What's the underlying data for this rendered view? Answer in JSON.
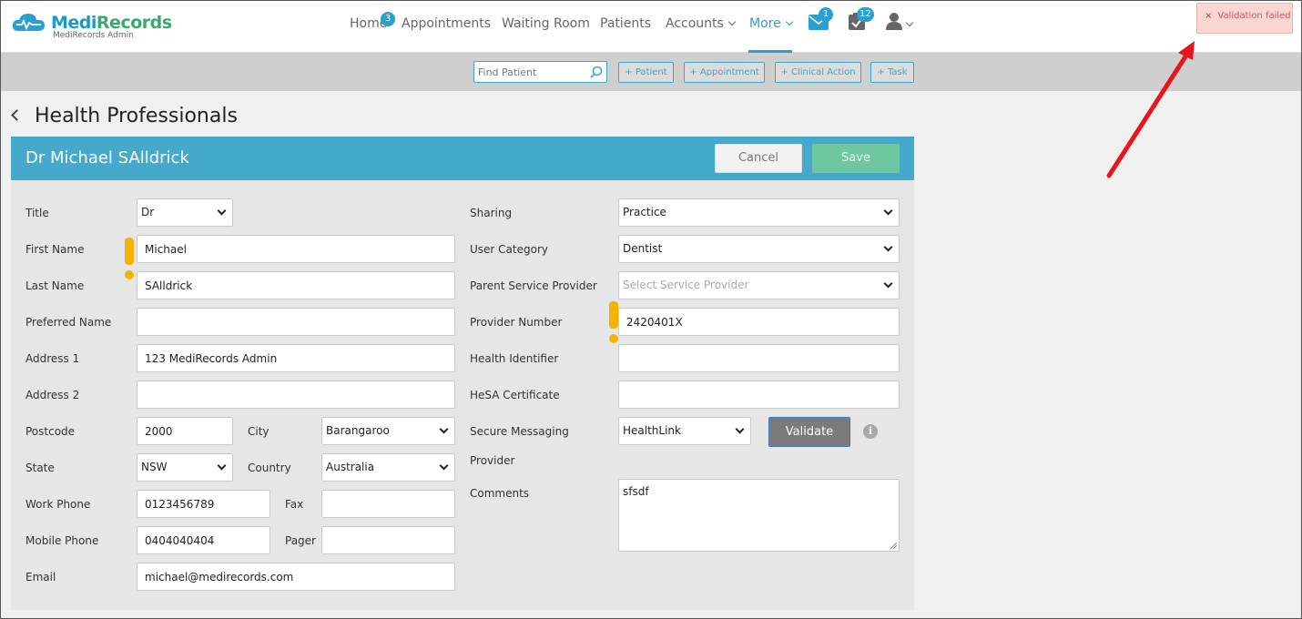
{
  "brand": {
    "name_a": "Medi",
    "name_b": "Records",
    "sub": "MediRecords Admin"
  },
  "nav": {
    "home": "Home",
    "home_badge": "3",
    "appointments": "Appointments",
    "waiting_room": "Waiting Room",
    "patients": "Patients",
    "accounts": "Accounts",
    "more": "More",
    "mail_badge": "1",
    "tasks_badge": "12"
  },
  "toast": {
    "close": "×",
    "message": "Validation failed"
  },
  "actionbar": {
    "find_placeholder": "Find Patient",
    "patient": "+ Patient",
    "appointment": "+ Appointment",
    "clinical_action": "+ Clinical Action",
    "task": "+ Task"
  },
  "page": {
    "title": "Health Professionals"
  },
  "panel": {
    "name": "Dr Michael SAlldrick",
    "cancel": "Cancel",
    "save": "Save"
  },
  "form": {
    "title_label": "Title",
    "title_value": "Dr",
    "first_name_label": "First Name",
    "first_name_value": "Michael",
    "last_name_label": "Last Name",
    "last_name_value": "SAlldrick",
    "preferred_name_label": "Preferred Name",
    "preferred_name_value": "",
    "address1_label": "Address 1",
    "address1_value": "123 MediRecords Admin",
    "address2_label": "Address 2",
    "address2_value": "",
    "postcode_label": "Postcode",
    "postcode_value": "2000",
    "city_label": "City",
    "city_value": "Barangaroo",
    "state_label": "State",
    "state_value": "NSW",
    "country_label": "Country",
    "country_value": "Australia",
    "work_phone_label": "Work Phone",
    "work_phone_value": "0123456789",
    "fax_label": "Fax",
    "fax_value": "",
    "mobile_phone_label": "Mobile Phone",
    "mobile_phone_value": "0404040404",
    "pager_label": "Pager",
    "pager_value": "",
    "email_label": "Email",
    "email_value": "michael@medirecords.com",
    "sharing_label": "Sharing",
    "sharing_value": "Practice",
    "user_category_label": "User Category",
    "user_category_value": "Dentist",
    "parent_sp_label": "Parent Service Provider",
    "parent_sp_placeholder": "Select Service Provider",
    "provider_number_label": "Provider Number",
    "provider_number_value": "2420401X",
    "health_identifier_label": "Health Identifier",
    "health_identifier_value": "",
    "hesa_label": "HeSA Certificate",
    "hesa_value": "",
    "secure_messaging_label": "Secure Messaging",
    "secure_messaging_value": "HealthLink",
    "validate": "Validate",
    "provider_label": "Provider",
    "comments_label": "Comments",
    "comments_value": "sfsdf",
    "info_glyph": "i"
  },
  "colors": {
    "accent": "#44a9cb",
    "save": "#6fc7a0",
    "warning": "#f5b301",
    "error": "#d9534f"
  }
}
